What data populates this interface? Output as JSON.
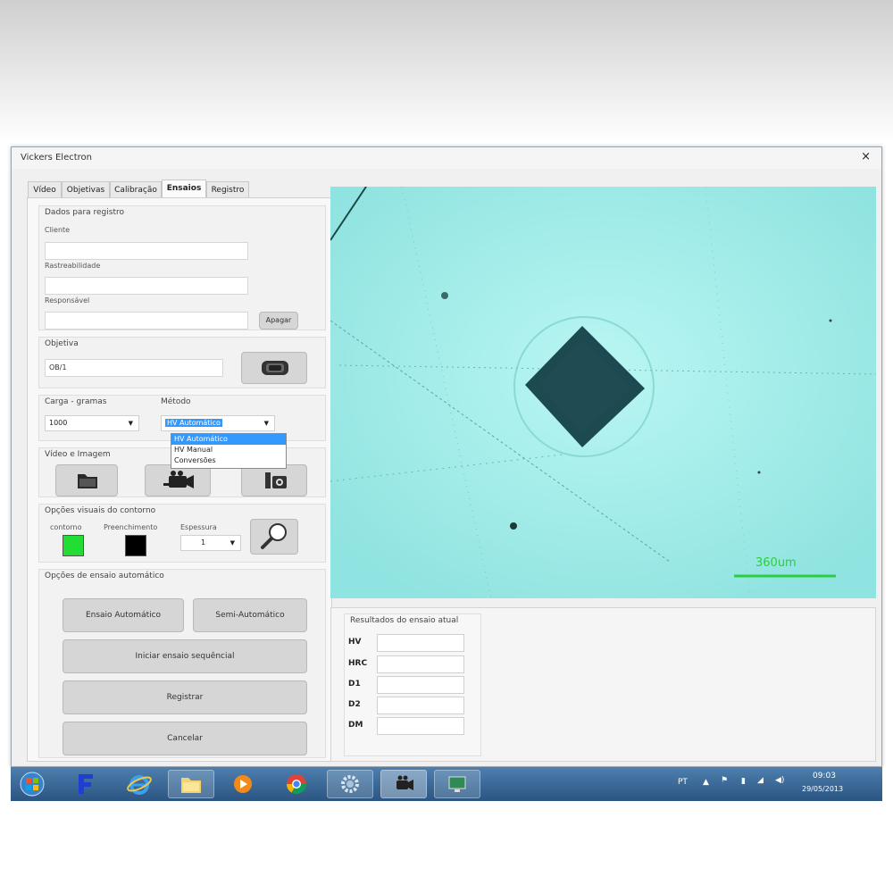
{
  "window": {
    "title": "Vickers Electron",
    "close_glyph": "×"
  },
  "tabs": [
    {
      "label": "Vídeo"
    },
    {
      "label": "Objetivas"
    },
    {
      "label": "Calibração"
    },
    {
      "label": "Ensaios",
      "active": true
    },
    {
      "label": "Registro"
    }
  ],
  "registro": {
    "title": "Dados para registro",
    "cliente_label": "Cliente",
    "cliente_value": "",
    "rastreabilidade_label": "Rastreabilidade",
    "rastreabilidade_value": "",
    "responsavel_label": "Responsável",
    "responsavel_value": "",
    "apagar_label": "Apagar"
  },
  "objetiva": {
    "title": "Objetiva",
    "value": "OB/1"
  },
  "carga": {
    "title": "Carga - gramas",
    "value": "1000"
  },
  "metodo": {
    "title": "Método",
    "value": "HV Automático",
    "options": [
      "HV Automático",
      "HV Manual",
      "Conversões"
    ],
    "selected_index": 0
  },
  "video_imagem": {
    "title": "Vídeo e Imagem"
  },
  "contorno": {
    "title": "Opções visuais do contorno",
    "contorno_label": "contorno",
    "contorno_color": "#22dd33",
    "preenchimento_label": "Preenchimento",
    "preenchimento_color": "#000000",
    "espessura_label": "Espessura",
    "espessura_value": "1"
  },
  "automatico": {
    "title": "Opções de ensaio automático",
    "ensaio_auto_label": "Ensaio Automático",
    "semi_auto_label": "Semi-Automático",
    "sequencial_label": "Iniciar ensaio sequêncial",
    "registrar_label": "Registrar",
    "cancelar_label": "Cancelar"
  },
  "image": {
    "scale_label": "360um",
    "background_color": "#9fecea",
    "accent_color": "#2ecc40"
  },
  "results": {
    "title": "Resultados do ensaio atual",
    "rows": [
      {
        "label": "HV",
        "value": ""
      },
      {
        "label": "HRC",
        "value": ""
      },
      {
        "label": "D1",
        "value": ""
      },
      {
        "label": "D2",
        "value": ""
      },
      {
        "label": "DM",
        "value": ""
      }
    ]
  },
  "taskbar": {
    "apps": [
      "start-orb",
      "f-app",
      "internet-explorer",
      "file-explorer",
      "media-player",
      "chrome",
      "settings-app",
      "camera-app",
      "remote-app"
    ],
    "language": "PT",
    "time": "09:03",
    "date": "29/05/2013"
  }
}
